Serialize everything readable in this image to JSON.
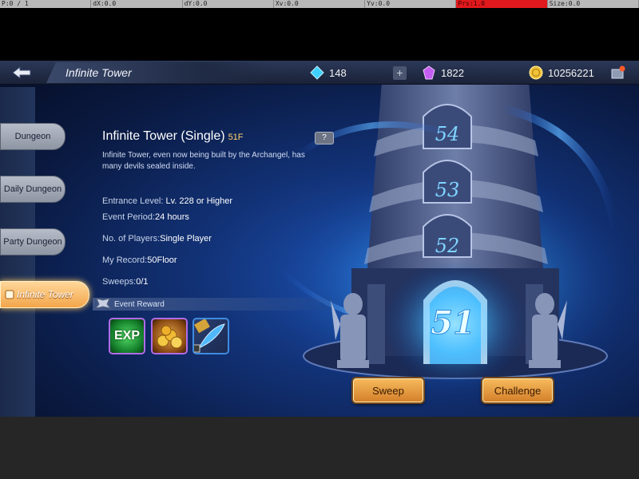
{
  "debug_bar": [
    "P:0 / 1",
    "dX:0.0",
    "dY:0.0",
    "Xv:0.0",
    "Yv:0.0",
    "Prs:1.0",
    "Size:0.0"
  ],
  "header": {
    "title": "Infinite Tower",
    "diamonds": "148",
    "crystals": "1822",
    "gold": "10256221"
  },
  "side_menu": [
    {
      "label": "Dungeon",
      "active": false
    },
    {
      "label": "Daily Dungeon",
      "active": false
    },
    {
      "label": "Party Dungeon",
      "active": false
    },
    {
      "label": "Infinite Tower",
      "active": true
    }
  ],
  "stage": {
    "title": "Infinite Tower (Single)",
    "floor": "51F",
    "help": "?",
    "description": "Infinite Tower, even now being built by the Archangel, has many devils sealed inside.",
    "entrance_label": "Entrance Level:",
    "entrance_value": " Lv. 228  or Higher",
    "period_label": "Event Period:",
    "period_value": "24 hours",
    "players_label": "No. of Players:",
    "players_value": "Single Player",
    "record_label": "My Record:",
    "record_value": "50Floor",
    "sweeps_label": "Sweeps:",
    "sweeps_value": "0/1"
  },
  "reward": {
    "title": "Event Reward",
    "items": [
      "EXP",
      "gold-coins-icon",
      "first-clear-feather-icon"
    ],
    "exp_label": "EXP"
  },
  "tower": {
    "floors": [
      "54",
      "53",
      "52",
      "51"
    ]
  },
  "buttons": {
    "sweep": "Sweep",
    "challenge": "Challenge"
  }
}
